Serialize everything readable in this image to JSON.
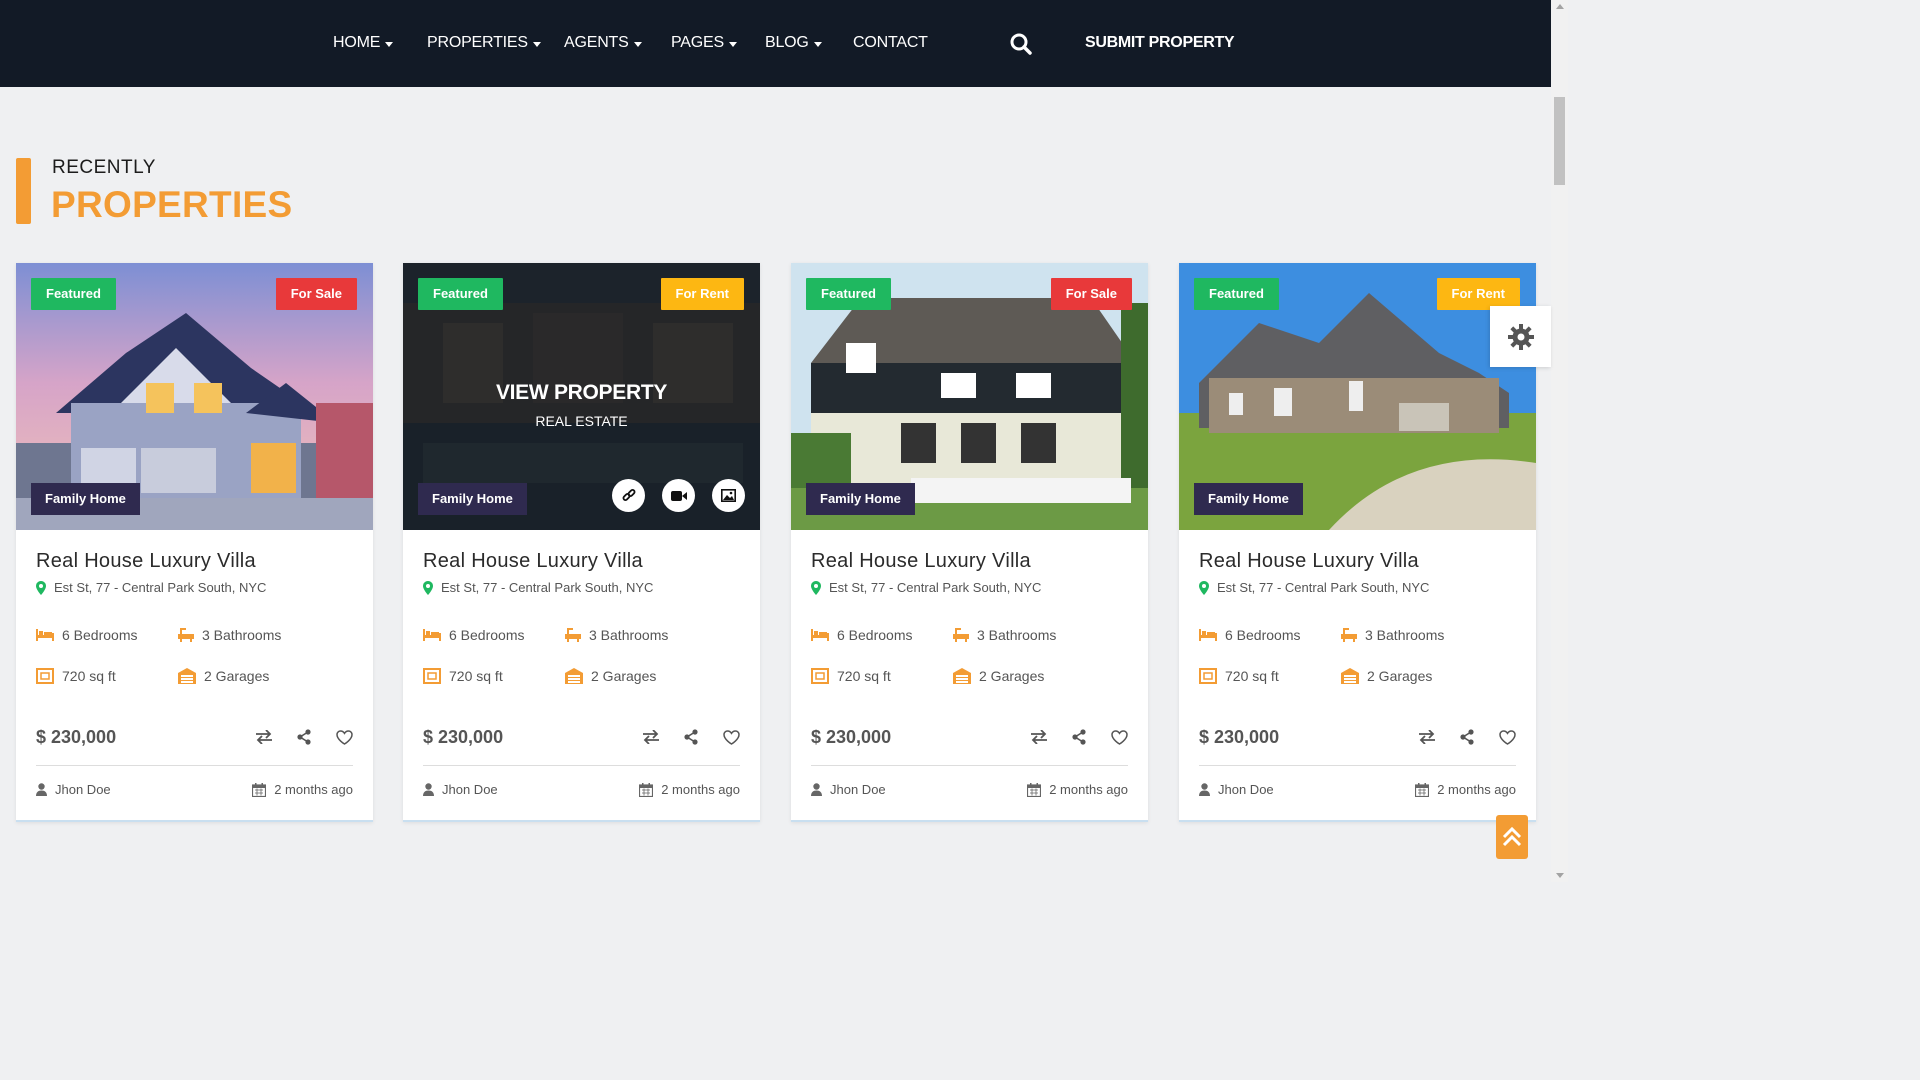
{
  "nav": {
    "items": [
      {
        "label": "HOME",
        "dropdown": true
      },
      {
        "label": "PROPERTIES",
        "dropdown": true
      },
      {
        "label": "AGENTS",
        "dropdown": true
      },
      {
        "label": "PAGES",
        "dropdown": true
      },
      {
        "label": "BLOG",
        "dropdown": true
      },
      {
        "label": "CONTACT",
        "dropdown": false
      }
    ],
    "search_icon": "search-icon",
    "submit_label": "SUBMIT PROPERTY"
  },
  "section": {
    "small_title": "RECENTLY",
    "big_title": "PROPERTIES"
  },
  "colors": {
    "nav_bg": "#121a26",
    "accent": "#f39c34",
    "featured": "#1fb860",
    "for_sale": "#e8393a",
    "for_rent": "#fdb712",
    "family": "#2f2a4f"
  },
  "cards": [
    {
      "featured": "Featured",
      "status": "For Sale",
      "category": "Family Home",
      "title": "Real House Luxury Villa",
      "address": "Est St, 77 - Central Park South, NYC",
      "bedrooms": "6 Bedrooms",
      "bathrooms": "3 Bathrooms",
      "area": "720 sq ft",
      "garages": "2 Garages",
      "price": "$ 230,000",
      "author": "Jhon Doe",
      "date": "2 months ago"
    },
    {
      "featured": "Featured",
      "status": "For Rent",
      "category": "Family Home",
      "overlay_title": "VIEW PROPERTY",
      "overlay_sub": "REAL ESTATE",
      "title": "Real House Luxury Villa",
      "address": "Est St, 77 - Central Park South, NYC",
      "bedrooms": "6 Bedrooms",
      "bathrooms": "3 Bathrooms",
      "area": "720 sq ft",
      "garages": "2 Garages",
      "price": "$ 230,000",
      "author": "Jhon Doe",
      "date": "2 months ago"
    },
    {
      "featured": "Featured",
      "status": "For Sale",
      "category": "Family Home",
      "title": "Real House Luxury Villa",
      "address": "Est St, 77 - Central Park South, NYC",
      "bedrooms": "6 Bedrooms",
      "bathrooms": "3 Bathrooms",
      "area": "720 sq ft",
      "garages": "2 Garages",
      "price": "$ 230,000",
      "author": "Jhon Doe",
      "date": "2 months ago"
    },
    {
      "featured": "Featured",
      "status": "For Rent",
      "category": "Family Home",
      "title": "Real House Luxury Villa",
      "address": "Est St, 77 - Central Park South, NYC",
      "bedrooms": "6 Bedrooms",
      "bathrooms": "3 Bathrooms",
      "area": "720 sq ft",
      "garages": "2 Garages",
      "price": "$ 230,000",
      "author": "Jhon Doe",
      "date": "2 months ago"
    }
  ]
}
